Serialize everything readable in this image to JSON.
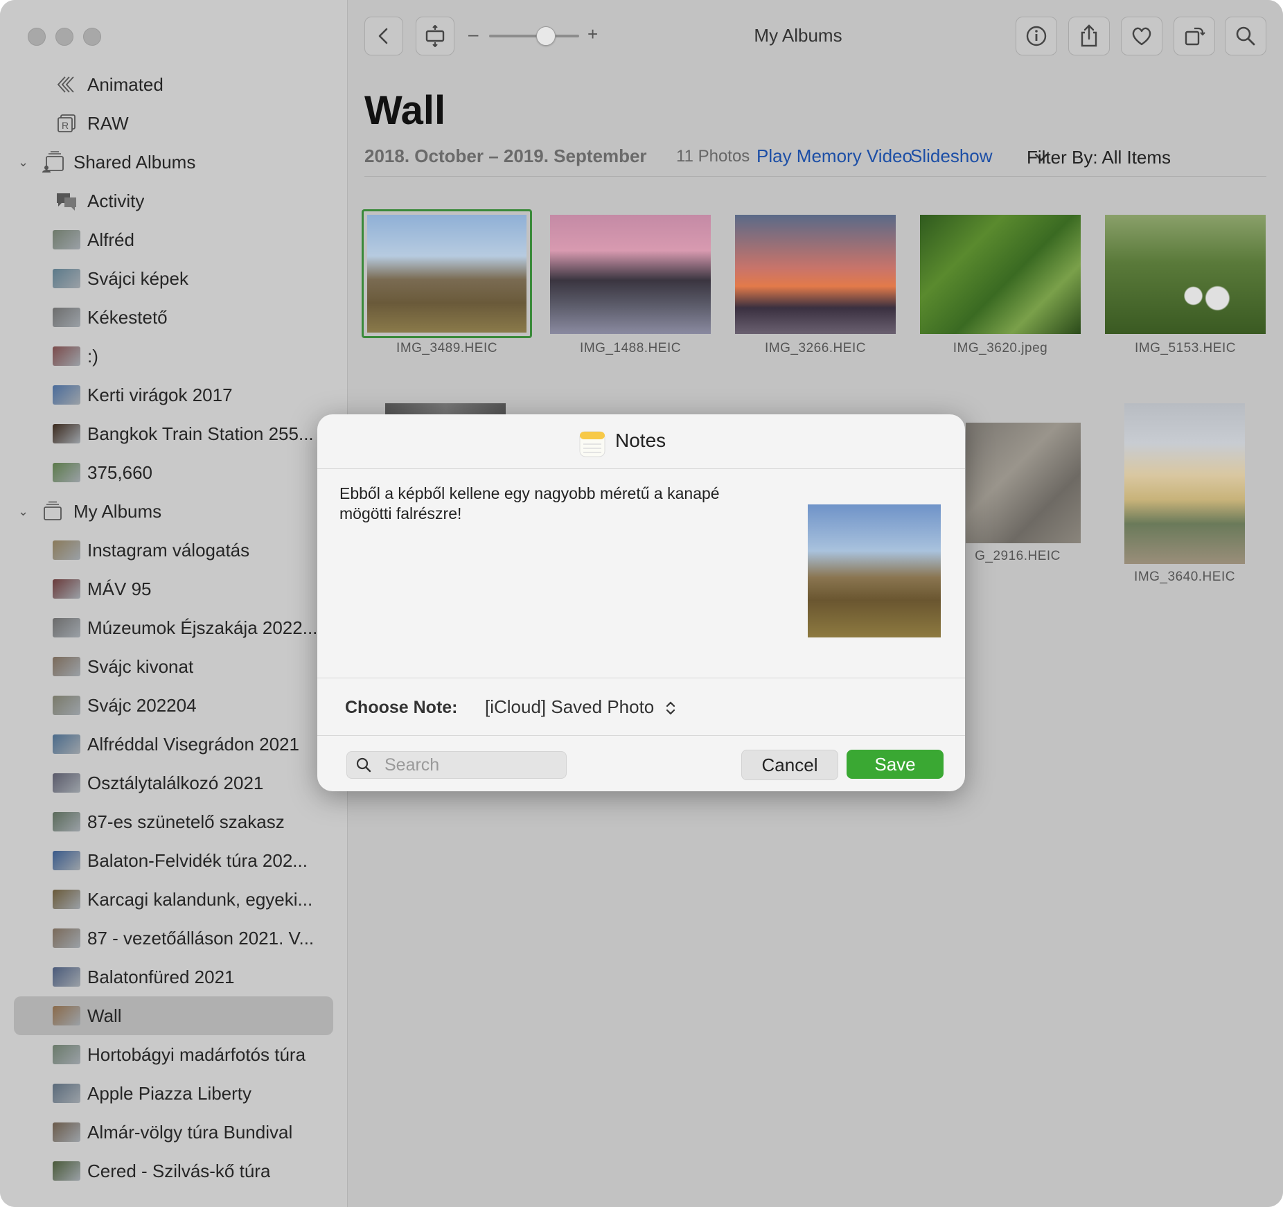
{
  "sidebar": {
    "items": [
      {
        "label": "Animated",
        "kind": "child",
        "icon": "animated-icon"
      },
      {
        "label": "RAW",
        "kind": "child",
        "icon": "raw-icon"
      },
      {
        "label": "Shared Albums",
        "kind": "section",
        "icon": "shared-albums-icon"
      },
      {
        "label": "Activity",
        "kind": "child",
        "icon": "activity-icon"
      },
      {
        "label": "Alfréd",
        "kind": "child",
        "thumb": "#6f7a6b"
      },
      {
        "label": "Svájci képek",
        "kind": "child",
        "thumb": "#5c7a8a"
      },
      {
        "label": "Kékestető",
        "kind": "child",
        "thumb": "#6d6d6d"
      },
      {
        "label": ":)",
        "kind": "child",
        "thumb": "#7b4b4b"
      },
      {
        "label": "Kerti virágok 2017",
        "kind": "child",
        "thumb": "#4a6b9a"
      },
      {
        "label": "Bangkok Train Station 255...",
        "kind": "child",
        "thumb": "#3b2a1e"
      },
      {
        "label": "375,660",
        "kind": "child",
        "thumb": "#5b7a4a"
      },
      {
        "label": "My Albums",
        "kind": "section",
        "icon": "my-albums-icon"
      },
      {
        "label": "Instagram válogatás",
        "kind": "child",
        "thumb": "#8a7a5a"
      },
      {
        "label": "MÁV 95",
        "kind": "child",
        "thumb": "#6a3b3b"
      },
      {
        "label": "Múzeumok Éjszakája 2022...",
        "kind": "child",
        "thumb": "#6b6b6b"
      },
      {
        "label": "Svájc kivonat",
        "kind": "child",
        "thumb": "#7a6a5a"
      },
      {
        "label": "Svájc 202204",
        "kind": "child",
        "thumb": "#7a7a6a"
      },
      {
        "label": "Alfréddal Visegrádon 2021",
        "kind": "child",
        "thumb": "#4a6a8a"
      },
      {
        "label": "Osztálytalálkozó 2021",
        "kind": "child",
        "thumb": "#5a5a6a"
      },
      {
        "label": "87-es szünetelő szakasz",
        "kind": "child",
        "thumb": "#5a6a5a"
      },
      {
        "label": "Balaton-Felvidék túra 202...",
        "kind": "child",
        "thumb": "#3a5a8a"
      },
      {
        "label": "Karcagi kalandunk, egyeki...",
        "kind": "child",
        "thumb": "#6a5a3a"
      },
      {
        "label": "87 - vezetőálláson 2021. V...",
        "kind": "child",
        "thumb": "#7a6a5a"
      },
      {
        "label": "Balatonfüred 2021",
        "kind": "child",
        "thumb": "#4a5a7a"
      },
      {
        "label": "Wall",
        "kind": "child",
        "thumb": "#8a6a4a",
        "selected": true
      },
      {
        "label": "Hortobágyi madárfotós túra",
        "kind": "child",
        "thumb": "#6a7a6a"
      },
      {
        "label": "Apple Piazza Liberty",
        "kind": "child",
        "thumb": "#5a6a7a"
      },
      {
        "label": "Almár-völgy túra Bundival",
        "kind": "child",
        "thumb": "#6a5a4a"
      },
      {
        "label": "Cered - Szilvás-kő túra",
        "kind": "child",
        "thumb": "#4a5a3a"
      }
    ]
  },
  "toolbar": {
    "title": "My Albums",
    "zoom_minus": "–",
    "zoom_plus": "+",
    "zoom_level": 0.62
  },
  "album": {
    "title": "Wall",
    "date_range": "2018. October – 2019. September",
    "count": "11 Photos",
    "play_memory": "Play Memory Video",
    "slideshow": "Slideshow",
    "filter": "Filter By: All Items"
  },
  "photos": [
    {
      "name": "IMG_3489.HEIC",
      "selected": true
    },
    {
      "name": "IMG_1488.HEIC"
    },
    {
      "name": "IMG_3266.HEIC"
    },
    {
      "name": "IMG_3620.jpeg"
    },
    {
      "name": "IMG_5153.HEIC"
    },
    {
      "name": "G_2916.HEIC"
    },
    {
      "name": "IMG_3640.HEIC"
    }
  ],
  "dialog": {
    "title": "Notes",
    "text": "Ebből a képből kellene egy nagyobb méretű a kanapé mögötti falrészre!",
    "choose_label": "Choose Note:",
    "choose_value": "[iCloud] Saved Photo",
    "search_placeholder": "Search",
    "cancel": "Cancel",
    "save": "Save"
  },
  "colors": {
    "accent_link": "#1d4fa6",
    "save_green": "#3aa833",
    "selection_green": "#3a8a3a"
  }
}
